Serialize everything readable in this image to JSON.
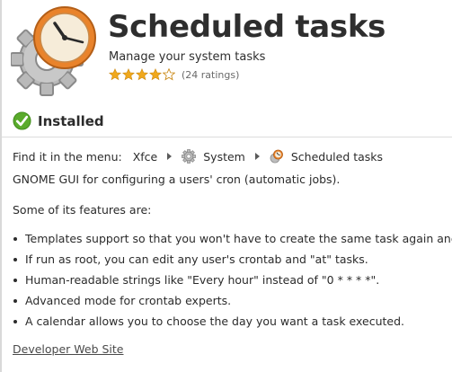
{
  "app": {
    "title": "Scheduled tasks",
    "subtitle": "Manage your system tasks",
    "icon": "clock-gear-icon",
    "rating": {
      "stars": 4,
      "max_stars": 5,
      "count_text": "(24 ratings)"
    }
  },
  "status": {
    "label": "Installed",
    "icon": "check-circle-icon",
    "color": "#5aab2c"
  },
  "menu_path": {
    "prefix": "Find it in the menu:",
    "items": [
      {
        "label": "Xfce",
        "icon": ""
      },
      {
        "label": "System",
        "icon": "gear-icon"
      },
      {
        "label": "Scheduled tasks",
        "icon": "clock-gear-icon"
      }
    ]
  },
  "description": "GNOME GUI for configuring a users' cron (automatic jobs).",
  "features_heading": "Some of its features are:",
  "features": [
    "Templates support so that you won't have to create the same task again and aga",
    "If run as root, you can edit any user's crontab and \"at\" tasks.",
    "Human-readable strings like \"Every hour\" instead of \"0 * * * *\".",
    "Advanced mode for crontab experts.",
    "A calendar allows you to choose the day you want a task executed."
  ],
  "links": {
    "developer": "Developer Web Site"
  },
  "colors": {
    "star": "#f0a81c",
    "accent_orange": "#e9832b",
    "gear_gray": "#9a9a9a"
  }
}
